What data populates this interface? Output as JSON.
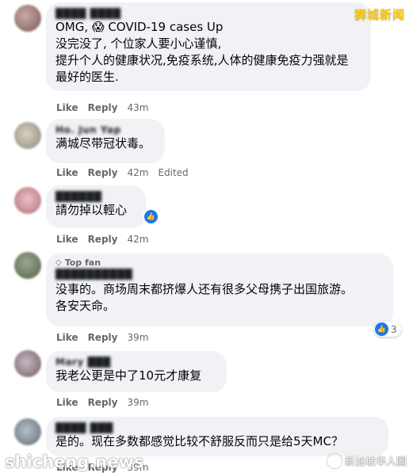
{
  "watermarks": {
    "top_right": "狮城新闻",
    "bottom_left": "shicheng.news",
    "bottom_right": "新加坡华人圈"
  },
  "colors": {
    "reaction_blue": "#1877f2",
    "bubble_bg": "#f0f2f5",
    "meta_gray": "#65676b"
  },
  "comments": [
    {
      "author": "████ ████",
      "text": "OMG, 😱 COVID-19 cases Up\n没完没了, 个位家人要小心谨慎,\n提升个人的健康状况,免疫系统,人体的健康免疫力强就是\n最好的医生.",
      "like": "Like",
      "reply": "Reply",
      "time": "43m"
    },
    {
      "author": "Ho. Jun Yap",
      "text": "满城尽带冠状毒。",
      "like": "Like",
      "reply": "Reply",
      "time": "42m",
      "edited": "Edited"
    },
    {
      "author": "██████",
      "text": "請勿掉以輕心",
      "like": "Like",
      "reply": "Reply",
      "time": "42m",
      "reaction_icon": "thumbs-up-icon"
    },
    {
      "badge": "Top fan",
      "author": "██████████",
      "text": "没事的。商场周末都挤爆人还有很多父母携子出国旅游。\n各安天命。",
      "like": "Like",
      "reply": "Reply",
      "time": "39m",
      "reaction_count": "3"
    },
    {
      "author": "Mary ███",
      "text": "我老公更是中了10元才康复",
      "like": "Like",
      "reply": "Reply",
      "time": "39m"
    },
    {
      "author": "████ ███",
      "text": "是的。现在多数都感觉比较不舒服反而只是给5天MC？",
      "like": "Like",
      "reply": "Reply",
      "time": "39m"
    }
  ]
}
